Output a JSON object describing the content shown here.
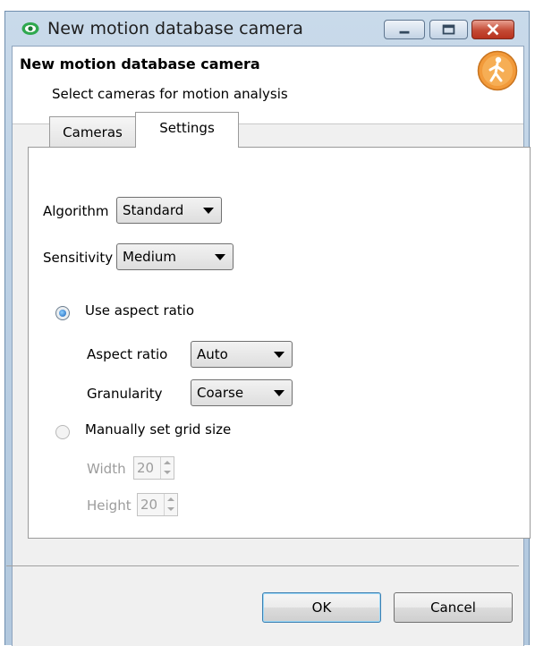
{
  "window": {
    "title": "New motion database camera",
    "controls": {
      "minimize_icon": "minimize-icon",
      "maximize_icon": "maximize-icon",
      "close_icon": "close-icon"
    }
  },
  "header": {
    "title": "New motion database camera",
    "subtitle": "Select cameras for motion analysis",
    "icon": "walking-person-icon"
  },
  "tabs": [
    {
      "label": "Cameras",
      "selected": false
    },
    {
      "label": "Settings",
      "selected": true
    }
  ],
  "settings": {
    "algorithm_label": "Algorithm",
    "algorithm_value": "Standard",
    "sensitivity_label": "Sensitivity",
    "sensitivity_value": "Medium",
    "use_aspect_ratio_label": "Use aspect ratio",
    "use_aspect_ratio_checked": true,
    "aspect_ratio_label": "Aspect ratio",
    "aspect_ratio_value": "Auto",
    "granularity_label": "Granularity",
    "granularity_value": "Coarse",
    "manual_grid_label": "Manually set grid size",
    "manual_grid_checked": false,
    "width_label": "Width",
    "width_value": "20",
    "height_label": "Height",
    "height_value": "20"
  },
  "buttons": {
    "ok": "OK",
    "cancel": "Cancel"
  },
  "colors": {
    "accent_orange": "#f29a3a",
    "title_icon_green": "#2fa84f",
    "close_red": "#c44a35"
  }
}
